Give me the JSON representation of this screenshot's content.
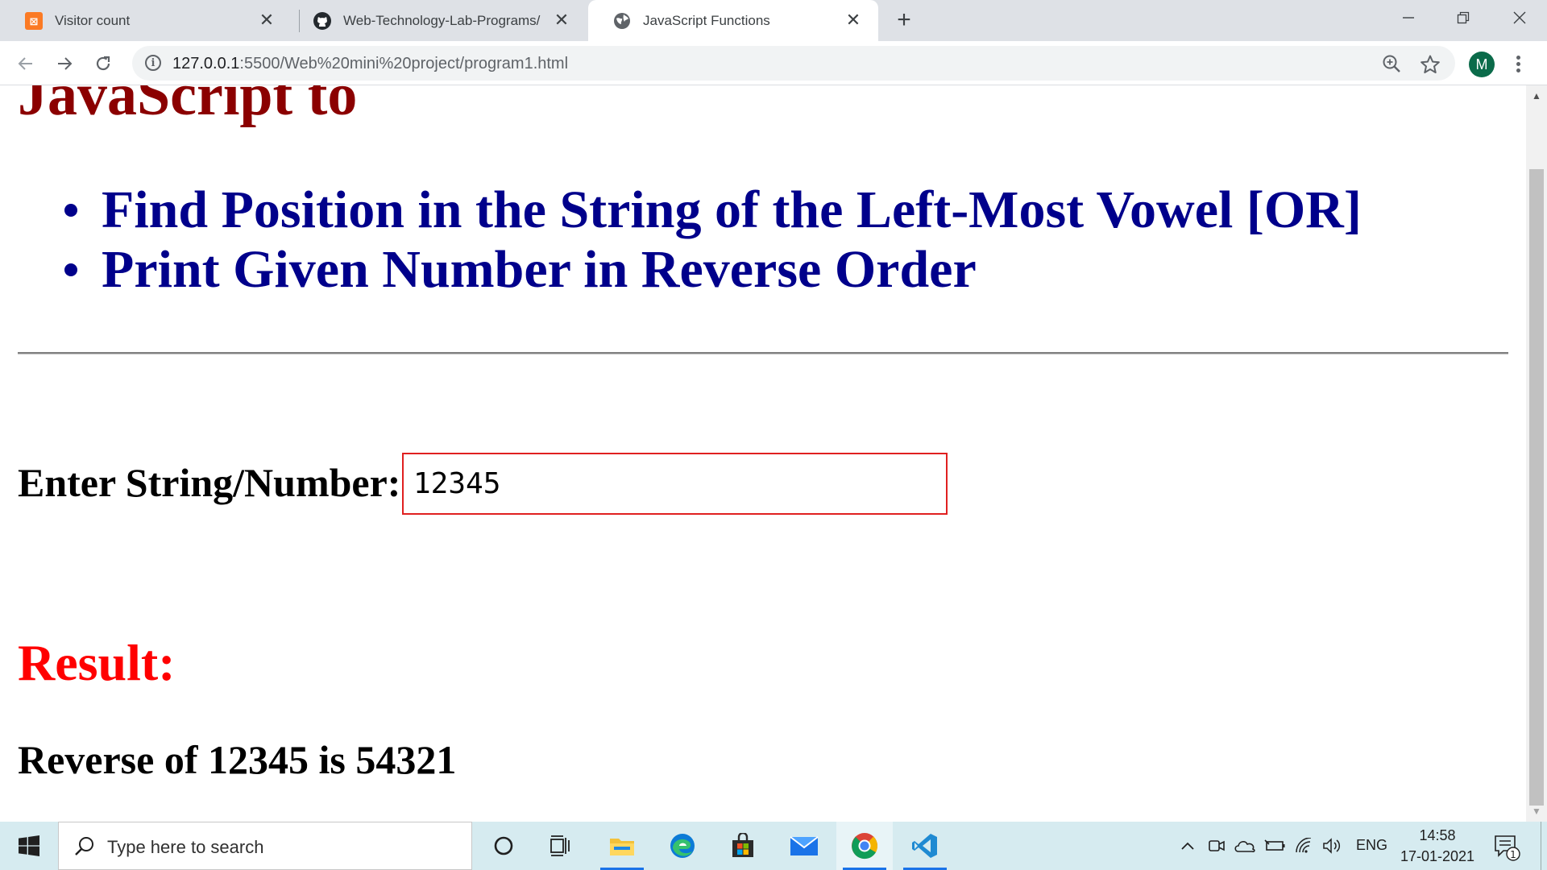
{
  "browser": {
    "tabs": [
      {
        "title": "Visitor count",
        "icon": "xampp-icon"
      },
      {
        "title": "Web-Technology-Lab-Programs/",
        "icon": "github-icon"
      },
      {
        "title": "JavaScript Functions",
        "icon": "globe-icon"
      }
    ],
    "active_tab": 2,
    "url_host": "127.0.0.1",
    "url_path": ":5500/Web%20mini%20project/program1.html",
    "profile_initial": "M",
    "colors": {
      "tabstrip": "#dee1e6",
      "avatar": "#0b6b4a"
    }
  },
  "page": {
    "heading": "JavaScript to",
    "tasks": [
      "Find Position in the String of the Left-Most Vowel [OR]",
      "Print Given Number in Reverse Order"
    ],
    "input_label": "Enter String/Number:",
    "input_value": "12345",
    "result_heading": "Result:",
    "result_text": "Reverse of 12345 is 54321",
    "colors": {
      "heading": "#8b0000",
      "tasks": "#00008b",
      "result_heading": "#ff0000",
      "input_border": "#e02020"
    }
  },
  "taskbar": {
    "search_placeholder": "Type here to search",
    "pinned": [
      "cortana-icon",
      "task-view-icon",
      "file-explorer-icon",
      "edge-icon",
      "store-icon",
      "mail-icon",
      "chrome-icon",
      "vscode-icon"
    ],
    "tray": [
      "chevron-up-icon",
      "meet-now-icon",
      "onedrive-icon",
      "battery-icon",
      "wifi-icon",
      "volume-icon"
    ],
    "language": "ENG",
    "time": "14:58",
    "date": "17-01-2021",
    "notification_count": "1"
  }
}
